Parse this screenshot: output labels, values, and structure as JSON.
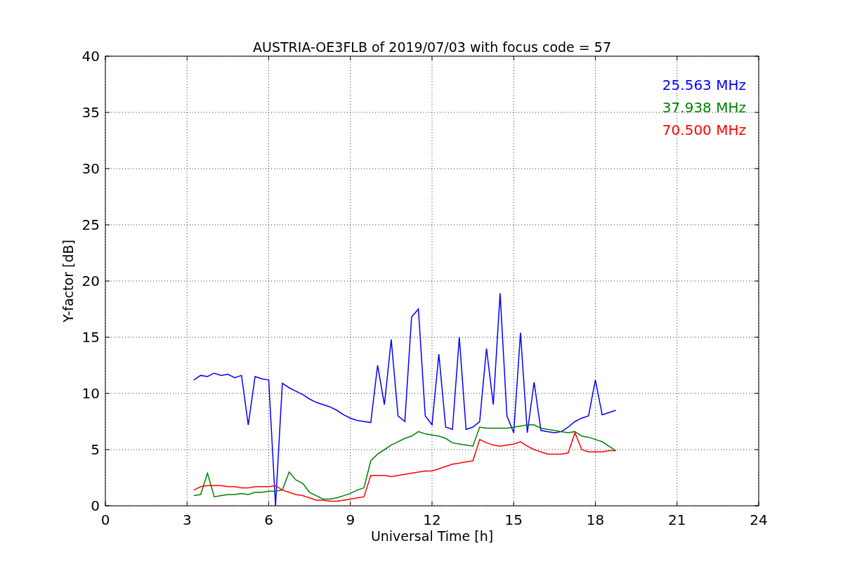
{
  "chart_data": {
    "type": "line",
    "title": "AUSTRIA-OE3FLB of 2019/07/03 with focus code = 57",
    "xlabel": "Universal Time [h]",
    "ylabel": "Y-factor [dB]",
    "x": [
      3.25,
      3.5,
      3.75,
      4,
      4.25,
      4.5,
      4.75,
      5,
      5.25,
      5.5,
      5.75,
      6,
      6.25,
      6.5,
      6.75,
      7,
      7.25,
      7.5,
      7.75,
      8,
      8.25,
      8.5,
      8.75,
      9,
      9.25,
      9.5,
      9.75,
      10,
      10.25,
      10.5,
      10.75,
      11,
      11.25,
      11.5,
      11.75,
      12,
      12.25,
      12.5,
      12.75,
      13,
      13.25,
      13.5,
      13.75,
      14,
      14.25,
      14.5,
      14.75,
      15,
      15.25,
      15.5,
      15.75,
      16,
      16.25,
      16.5,
      16.75,
      17,
      17.25,
      17.5,
      17.75,
      18,
      18.25,
      18.5,
      18.75
    ],
    "series": [
      {
        "name": "25.563 MHz",
        "color": "#0000ff",
        "values": [
          11.2,
          11.6,
          11.5,
          11.8,
          11.6,
          11.7,
          11.4,
          11.6,
          7.2,
          11.5,
          11.3,
          11.2,
          0,
          10.9,
          10.5,
          10.2,
          9.9,
          9.5,
          9.2,
          9.0,
          8.8,
          8.5,
          8.1,
          7.8,
          7.6,
          7.5,
          7.4,
          12.5,
          9.0,
          14.8,
          8.0,
          7.5,
          16.8,
          17.5,
          8.0,
          7.2,
          13.5,
          7.0,
          6.8,
          15.0,
          6.8,
          7.0,
          7.5,
          14.0,
          9.0,
          18.9,
          8.0,
          6.5,
          15.4,
          6.5,
          11.0,
          6.7,
          6.6,
          6.5,
          6.6,
          7.0,
          7.5,
          7.8,
          8.0,
          11.2,
          8.1,
          8.3,
          8.5
        ]
      },
      {
        "name": "37.938 MHz",
        "color": "#008000",
        "values": [
          0.9,
          1.0,
          2.9,
          0.8,
          0.9,
          1.0,
          1.0,
          1.1,
          1.0,
          1.2,
          1.2,
          1.3,
          1.3,
          1.4,
          3.0,
          2.3,
          2.0,
          1.2,
          0.9,
          0.6,
          0.6,
          0.7,
          0.9,
          1.1,
          1.4,
          1.6,
          4.0,
          4.6,
          5.0,
          5.4,
          5.7,
          6.0,
          6.2,
          6.6,
          6.4,
          6.3,
          6.2,
          6.0,
          5.6,
          5.5,
          5.4,
          5.3,
          7.0,
          6.9,
          6.9,
          6.9,
          6.9,
          7.0,
          7.1,
          7.2,
          7.2,
          6.9,
          6.8,
          6.7,
          6.6,
          6.5,
          6.6,
          6.2,
          6.1,
          5.9,
          5.7,
          5.3,
          4.9
        ]
      },
      {
        "name": "70.500 MHz",
        "color": "#ff0000",
        "values": [
          1.4,
          1.7,
          1.8,
          1.8,
          1.8,
          1.7,
          1.7,
          1.6,
          1.6,
          1.7,
          1.7,
          1.7,
          1.8,
          1.4,
          1.2,
          1.0,
          0.9,
          0.7,
          0.5,
          0.5,
          0.4,
          0.4,
          0.5,
          0.6,
          0.7,
          0.8,
          2.7,
          2.7,
          2.7,
          2.6,
          2.7,
          2.8,
          2.9,
          3.0,
          3.1,
          3.1,
          3.3,
          3.5,
          3.7,
          3.8,
          3.9,
          4.0,
          5.9,
          5.6,
          5.4,
          5.3,
          5.4,
          5.5,
          5.7,
          5.3,
          5.0,
          4.8,
          4.6,
          4.6,
          4.6,
          4.7,
          6.5,
          5.0,
          4.8,
          4.8,
          4.8,
          4.9,
          4.9
        ]
      }
    ],
    "grid": true,
    "xlim": [
      0,
      24
    ],
    "ylim": [
      0,
      40
    ],
    "xticks": [
      0,
      3,
      6,
      9,
      12,
      15,
      18,
      21,
      24
    ],
    "yticks": [
      0,
      5,
      10,
      15,
      20,
      25,
      30,
      35,
      40
    ]
  }
}
